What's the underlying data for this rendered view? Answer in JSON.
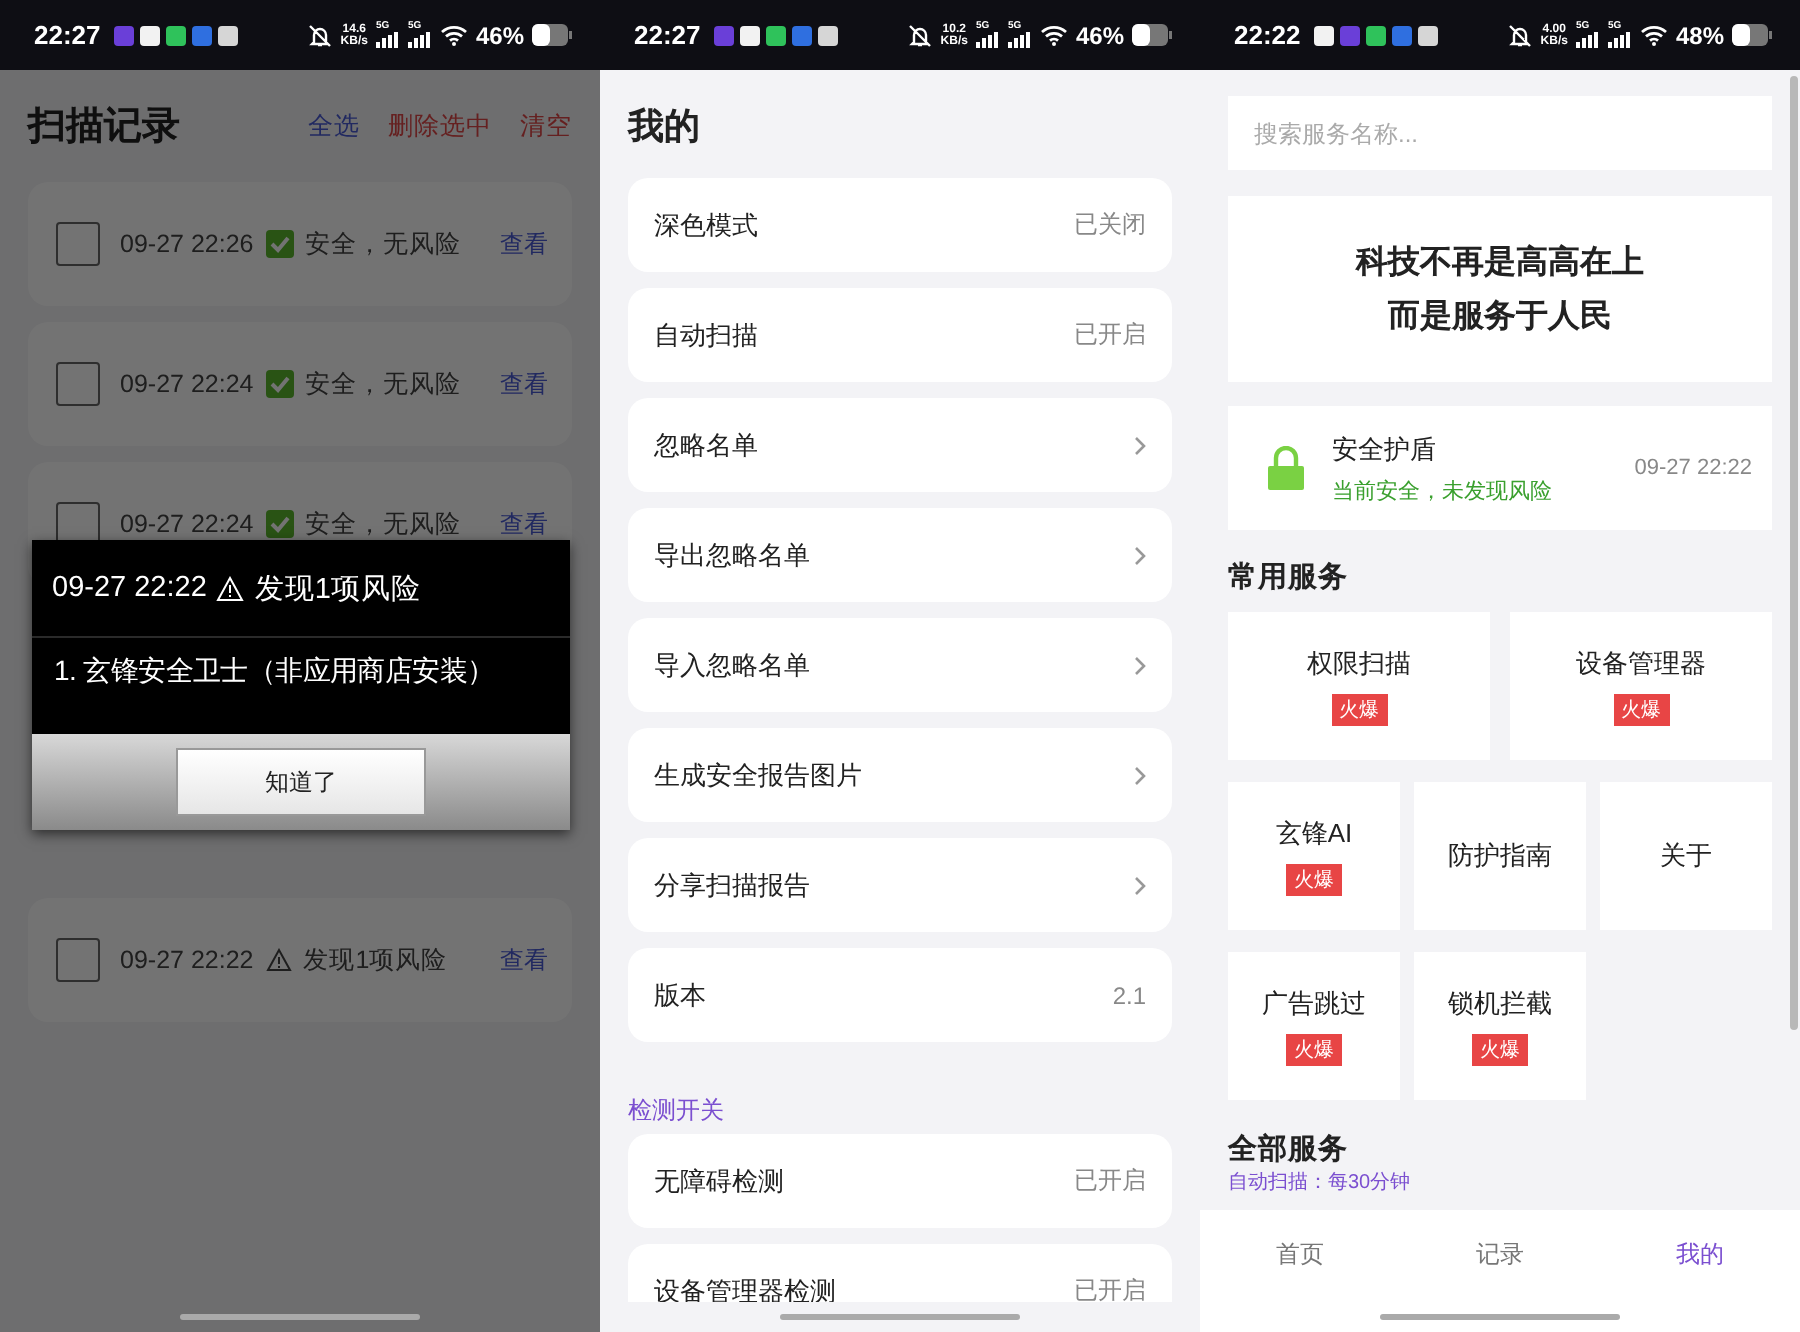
{
  "history": {
    "status_bar": {
      "time": "22:27",
      "notification_icons": [
        {
          "color": "#6a3fd8"
        },
        {
          "color": "#f2f2f2"
        },
        {
          "color": "#2fc25b"
        },
        {
          "color": "#2f6fe0"
        },
        {
          "color": "#d6d6d6"
        }
      ],
      "speed": "14.6",
      "speed_unit": "KB/s",
      "network": [
        "5G",
        "5G"
      ],
      "battery": "46%"
    },
    "title": "扫描记录",
    "actions": [
      {
        "label": "全选",
        "kind": "select"
      },
      {
        "label": "删除选中",
        "kind": "danger"
      },
      {
        "label": "清空",
        "kind": "danger"
      }
    ],
    "records": [
      {
        "checked": false,
        "time": "09-27 22:26",
        "kind": "safe",
        "status": "安全，无风险",
        "action": "查看"
      },
      {
        "checked": false,
        "time": "09-27 22:24",
        "kind": "safe",
        "status": "安全，无风险",
        "action": "查看"
      },
      {
        "checked": false,
        "time": "09-27 22:24",
        "kind": "safe",
        "status": "安全，无风险",
        "action": "查看"
      },
      {
        "checked": false,
        "time": "09-27 22:22",
        "kind": "risk",
        "status": "发现1项风险",
        "action": "查看"
      }
    ],
    "dialog": {
      "time": "09-27 22:22",
      "message": "发现1项风险",
      "items": [
        "1. 玄锋安全卫士（非应用商店安装）"
      ],
      "button": "知道了"
    }
  },
  "mine": {
    "status_bar": {
      "time": "22:27",
      "notification_icons": [
        {
          "color": "#6a3fd8"
        },
        {
          "color": "#f2f2f2"
        },
        {
          "color": "#2fc25b"
        },
        {
          "color": "#2f6fe0"
        },
        {
          "color": "#d6d6d6"
        }
      ],
      "speed": "10.2",
      "speed_unit": "KB/s",
      "network": [
        "5G",
        "5G"
      ],
      "battery": "46%"
    },
    "title": "我的",
    "settings": [
      {
        "label": "深色模式",
        "kind": "value",
        "value": "已关闭"
      },
      {
        "label": "自动扫描",
        "kind": "value",
        "value": "已开启"
      },
      {
        "label": "忽略名单",
        "kind": "link"
      },
      {
        "label": "导出忽略名单",
        "kind": "link"
      },
      {
        "label": "导入忽略名单",
        "kind": "link"
      },
      {
        "label": "生成安全报告图片",
        "kind": "link"
      },
      {
        "label": "分享扫描报告",
        "kind": "link"
      },
      {
        "label": "版本",
        "kind": "value",
        "value": "2.1"
      }
    ],
    "section": "检测开关",
    "detections": [
      {
        "label": "无障碍检测",
        "kind": "value",
        "value": "已开启"
      },
      {
        "label": "设备管理器检测",
        "kind": "value",
        "value": "已开启"
      }
    ]
  },
  "home": {
    "status_bar": {
      "time": "22:22",
      "notification_icons": [
        {
          "color": "#f2f2f2"
        },
        {
          "color": "#6a3fd8"
        },
        {
          "color": "#2fc25b"
        },
        {
          "color": "#2f6fe0"
        },
        {
          "color": "#d6d6d6"
        }
      ],
      "speed": "4.00",
      "speed_unit": "KB/s",
      "network": [
        "5G",
        "5G"
      ],
      "battery": "48%"
    },
    "search": {
      "placeholder": "搜索服务名称..."
    },
    "banner": [
      "科技不再是高高在上",
      "而是服务于人民"
    ],
    "shield": {
      "title": "安全护盾",
      "status": "当前安全，未发现风险",
      "time": "09-27 22:22"
    },
    "common_title": "常用服务",
    "service_rows": [
      {
        "kind": "wide",
        "tiles": [
          {
            "name": "权限扫描",
            "badge": "火爆"
          },
          {
            "name": "设备管理器",
            "badge": "火爆"
          }
        ]
      },
      {
        "kind": "compact",
        "tiles": [
          {
            "name": "玄锋AI",
            "badge": "火爆"
          },
          {
            "name": "防护指南"
          },
          {
            "name": "关于"
          }
        ]
      },
      {
        "kind": "compact",
        "tiles": [
          {
            "name": "广告跳过",
            "badge": "火爆"
          },
          {
            "name": "锁机拦截",
            "badge": "火爆"
          }
        ]
      }
    ],
    "all_title": "全部服务",
    "auto_scan": "自动扫描：每30分钟",
    "nav": [
      {
        "label": "首页",
        "selected": false
      },
      {
        "label": "记录",
        "selected": false
      },
      {
        "label": "我的",
        "selected": true
      }
    ]
  }
}
